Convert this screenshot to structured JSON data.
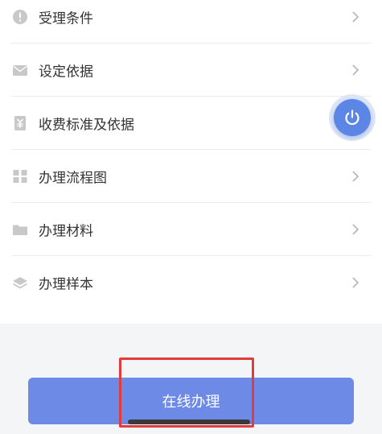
{
  "list": {
    "items": [
      {
        "label": "受理条件",
        "icon": "info-circle-icon"
      },
      {
        "label": "设定依据",
        "icon": "envelope-icon"
      },
      {
        "label": "收费标准及依据",
        "icon": "yen-document-icon"
      },
      {
        "label": "办理流程图",
        "icon": "grid-flow-icon"
      },
      {
        "label": "办理材料",
        "icon": "folder-icon"
      },
      {
        "label": "办理样本",
        "icon": "layers-icon"
      }
    ]
  },
  "floating": {
    "icon": "power-icon"
  },
  "actions": {
    "submit_label": "在线办理"
  },
  "colors": {
    "accent": "#6c8ae6",
    "power": "#5b86e5",
    "highlight": "#e33b3b",
    "icon_gray": "#c8c8c8"
  }
}
